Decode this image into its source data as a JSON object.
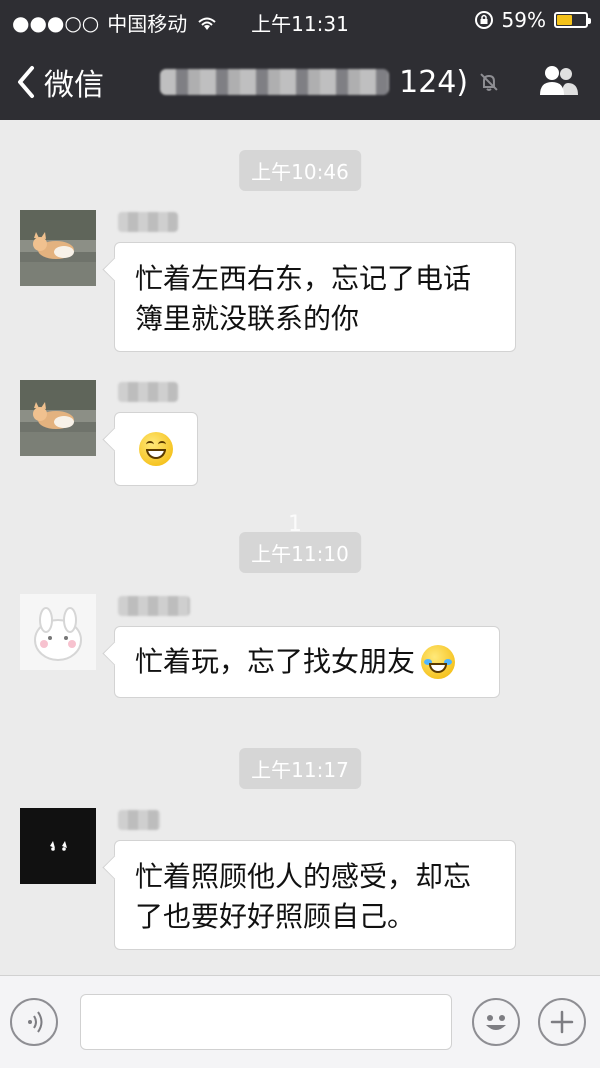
{
  "status_bar": {
    "signal": "●●●○○",
    "carrier": "中国移动",
    "time": "上午11:31",
    "battery_percent": "59%",
    "battery_level": 0.59
  },
  "nav": {
    "back_label": "微信",
    "group_count": "124)"
  },
  "chat": {
    "timestamps": [
      "上午10:46",
      "上午11:10",
      "上午11:17"
    ],
    "marker": "1",
    "messages": [
      {
        "text": "忙着左西右东，忘记了电话\n簿里就没联系的你"
      },
      {
        "text": ""
      },
      {
        "text": "忙着玩，忘了找女朋友"
      },
      {
        "text": "忙着照顾他人的感受，却忘\n了也要好好照顾自己。"
      }
    ]
  },
  "colors": {
    "nav_background": "#2e2e33",
    "chat_background": "#ebebeb",
    "battery_fill": "#f4c21a"
  },
  "icons": {
    "signal": "signal-dots-icon",
    "wifi": "wifi-icon",
    "lock": "rotation-lock-icon",
    "battery": "battery-icon",
    "back": "chevron-left-icon",
    "mute": "mute-bell-icon",
    "contacts": "group-contacts-icon",
    "voice": "voice-icon",
    "emoji": "emoji-icon",
    "add": "plus-icon"
  }
}
